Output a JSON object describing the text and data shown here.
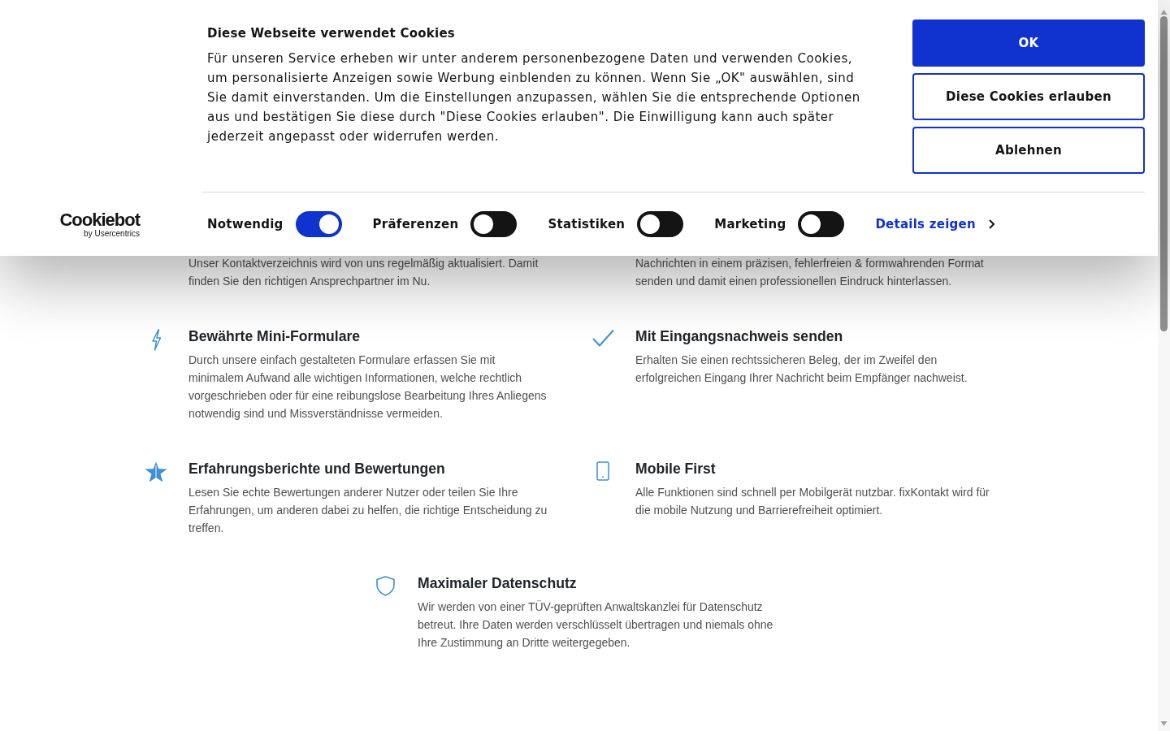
{
  "cookie_banner": {
    "logo": {
      "wordmark": "Cookiebot",
      "byline": "by Usercentrics"
    },
    "title": "Diese Webseite verwendet Cookies",
    "text": "Für unseren Service erheben wir unter anderem personenbezogene Daten und verwenden Cookies, um personalisierte Anzeigen sowie Werbung einblenden zu können. Wenn Sie „OK\" auswählen, sind Sie damit einverstanden. Um die Einstellungen anzupassen, wählen Sie die entsprechende Optionen aus und bestätigen Sie diese durch \"Diese Cookies erlauben\". Die Einwilligung kann auch später jederzeit angepasst oder widerrufen werden.",
    "buttons": [
      {
        "label": "OK",
        "kind": "primary"
      },
      {
        "label": "Diese Cookies erlauben",
        "kind": "outline"
      },
      {
        "label": "Ablehnen",
        "kind": "outline"
      }
    ],
    "toggles": [
      {
        "label": "Notwendig",
        "on": true
      },
      {
        "label": "Präferenzen",
        "on": false
      },
      {
        "label": "Statistiken",
        "on": false
      },
      {
        "label": "Marketing",
        "on": false
      }
    ],
    "details_link": "Details zeigen"
  },
  "features": [
    {
      "description": "Unser Kontaktverzeichnis wird von uns regelmäßig aktualisiert. Damit finden Sie den richtigen Ansprechpartner im Nu."
    },
    {
      "description": "Nachrichten in einem präzisen, fehlerfreien & formwahrenden Format senden und damit einen professionellen Eindruck hinterlassen."
    },
    {
      "title": "Bewährte Mini-Formulare",
      "description": "Durch unsere einfach gestalteten Formulare erfassen Sie mit minimalem Aufwand alle wichtigen Informationen, welche rechtlich vorgeschrieben oder für eine reibungslose Bearbeitung Ihres Anliegens notwendig sind und Missverständnisse vermeiden."
    },
    {
      "title": "Mit Eingangsnachweis senden",
      "description": "Erhalten Sie einen rechtssicheren Beleg, der im Zweifel den erfolgreichen Eingang Ihrer Nachricht beim Empfänger nachweist."
    },
    {
      "title": "Erfahrungsberichte und Bewertungen",
      "description": "Lesen Sie echte Bewertungen anderer Nutzer oder teilen Sie Ihre Erfahrungen, um anderen dabei zu helfen, die richtige Entscheidung zu treffen."
    },
    {
      "title": "Mobile First",
      "description": "Alle Funktionen sind schnell per Mobilgerät nutzbar. fixKontakt wird für die mobile Nutzung und Barrierefreiheit optimiert."
    },
    {
      "title": "Maximaler Datenschutz",
      "description": "Wir werden von einer TÜV-geprüften Anwaltskanzlei für Datenschutz betreut. Ihre Daten werden verschlüsselt übertragen und niemals ohne Ihre Zustimmung an Dritte weitergegeben."
    }
  ]
}
